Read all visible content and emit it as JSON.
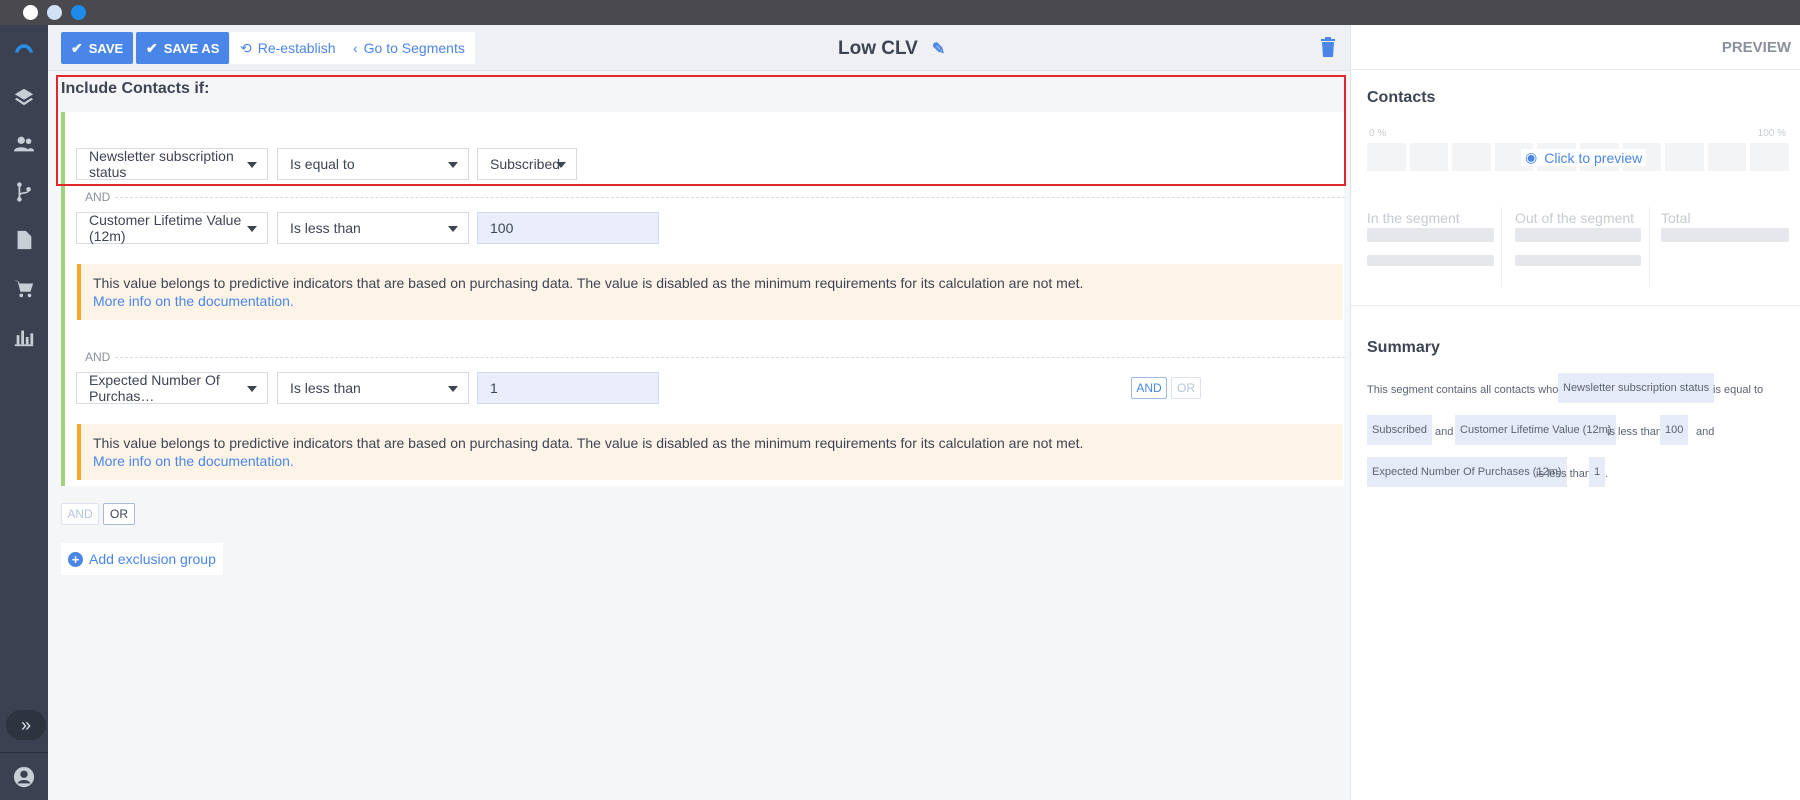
{
  "toolbar": {
    "save_label": "SAVE",
    "save_as_label": "SAVE AS",
    "reestablish_label": "Re-establish",
    "go_segments_label": "Go to Segments",
    "segment_title": "Low CLV"
  },
  "include": {
    "heading": "Include Contacts if:",
    "rules": [
      {
        "field": "Newsletter subscription status",
        "operator": "Is equal to",
        "value": "Subscribed"
      },
      {
        "field": "Customer Lifetime Value (12m)",
        "operator": "Is less than",
        "value": "100"
      },
      {
        "field": "Expected Number Of Purchas…",
        "operator": "Is less than",
        "value": "1"
      }
    ],
    "and_label": "AND",
    "warning_text": "This value belongs to predictive indicators that are based on purchasing data. The value is disabled as the minimum requirements for its calculation are not met.",
    "warning_link": "More info on the documentation.",
    "chip_and": "AND",
    "chip_or": "OR"
  },
  "bottom": {
    "and_label": "AND",
    "or_label": "OR",
    "add_exclusion_label": "Add exclusion group"
  },
  "preview": {
    "header": "PREVIEW",
    "contacts_title": "Contacts",
    "pct_min": "0 %",
    "pct_max": "100 %",
    "click_to_preview": "Click to preview",
    "in_segment": "In the segment",
    "out_segment": "Out of the segment",
    "total": "Total",
    "summary_title": "Summary",
    "summary": {
      "prefix": "This segment contains all contacts whose",
      "chip1": "Newsletter subscription status",
      "t1": "is equal to",
      "chip2": "Subscribed",
      "t2": "and",
      "chip3": "Customer Lifetime Value (12m)",
      "t3": "is less than",
      "chip4": "100",
      "t4": "and",
      "chip5": "Expected Number Of Purchases (12m)",
      "t5": "is less than",
      "chip6": "1",
      "t6": "."
    }
  },
  "colors": {
    "accent": "#4a86e8",
    "group_border": "#9fd27a",
    "warning_border": "#f5a623",
    "highlight": "#e0272b"
  }
}
